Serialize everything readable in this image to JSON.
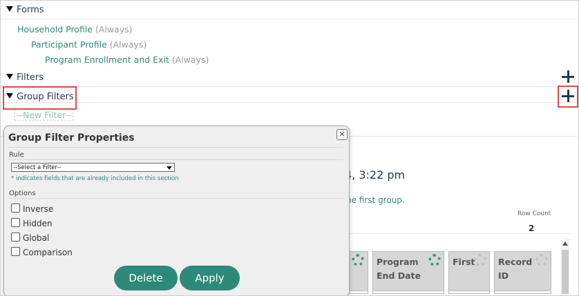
{
  "sections": {
    "forms": {
      "label": "Forms"
    },
    "filters": {
      "label": "Filters"
    },
    "group_filters": {
      "label": "Group Filters",
      "new_filter": "--New Filter--"
    }
  },
  "forms_list": [
    {
      "name": "Household Profile",
      "qualifier": "(Always)"
    },
    {
      "name": "Participant Profile",
      "qualifier": "(Always)"
    },
    {
      "name": "Program Enrollment and Exit",
      "qualifier": "(Always)"
    }
  ],
  "background": {
    "date_fragment": "4, 3:22 pm",
    "hint_fragment": "he first group.",
    "row_count_label": "Row Count",
    "row_count_value": "2"
  },
  "columns": [
    {
      "label": ""
    },
    {
      "label": "Program End Date"
    },
    {
      "label": "First"
    },
    {
      "label": "Record ID"
    }
  ],
  "dialog": {
    "title": "Group Filter Properties",
    "rule_label": "Rule",
    "select_value": "--Select a Filter--",
    "note": "* indicates fields that are already included in this section",
    "options_label": "Options",
    "options": [
      "Inverse",
      "Hidden",
      "Global",
      "Comparison"
    ],
    "delete_label": "Delete",
    "apply_label": "Apply"
  },
  "colors": {
    "accent": "#2e8a78",
    "highlight": "#e04848",
    "navy": "#1e3b56"
  }
}
